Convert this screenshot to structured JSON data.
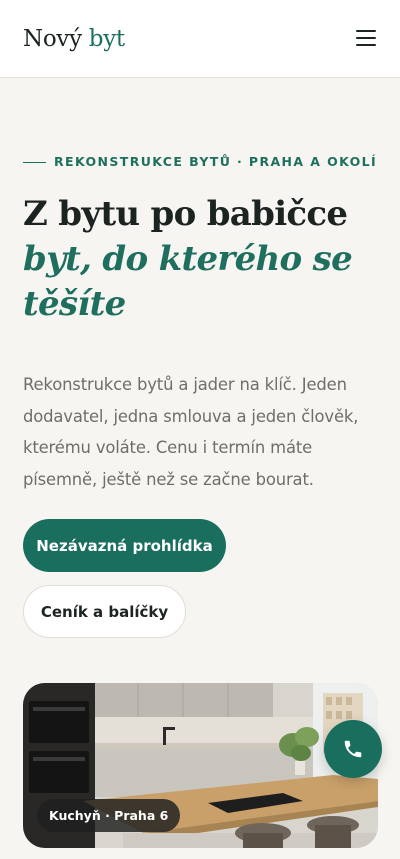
{
  "header": {
    "logo_part1": "Nový",
    "logo_part2": "byt",
    "menu_icon": "hamburger-menu-icon"
  },
  "hero": {
    "eyebrow": "REKONSTRUKCE BYTŮ · PRAHA A OKOLÍ",
    "title_line1": "Z bytu po babičce",
    "title_line2": "byt, do kterého se těšíte",
    "lead": "Rekonstrukce bytů a jader na klíč. Jeden dodavatel, jedna smlouva a jeden člověk, kterému voláte. Cenu i termín máte písemně, ještě než se začne bourat.",
    "primary_button": "Nezávazná prohlídka",
    "secondary_button": "Ceník a balíčky"
  },
  "photo": {
    "caption": "Kuchyň · Praha 6"
  },
  "fab": {
    "icon": "phone-icon"
  },
  "colors": {
    "accent": "#1f6f5f",
    "background": "#f7f5f1",
    "text": "#1c2422"
  }
}
